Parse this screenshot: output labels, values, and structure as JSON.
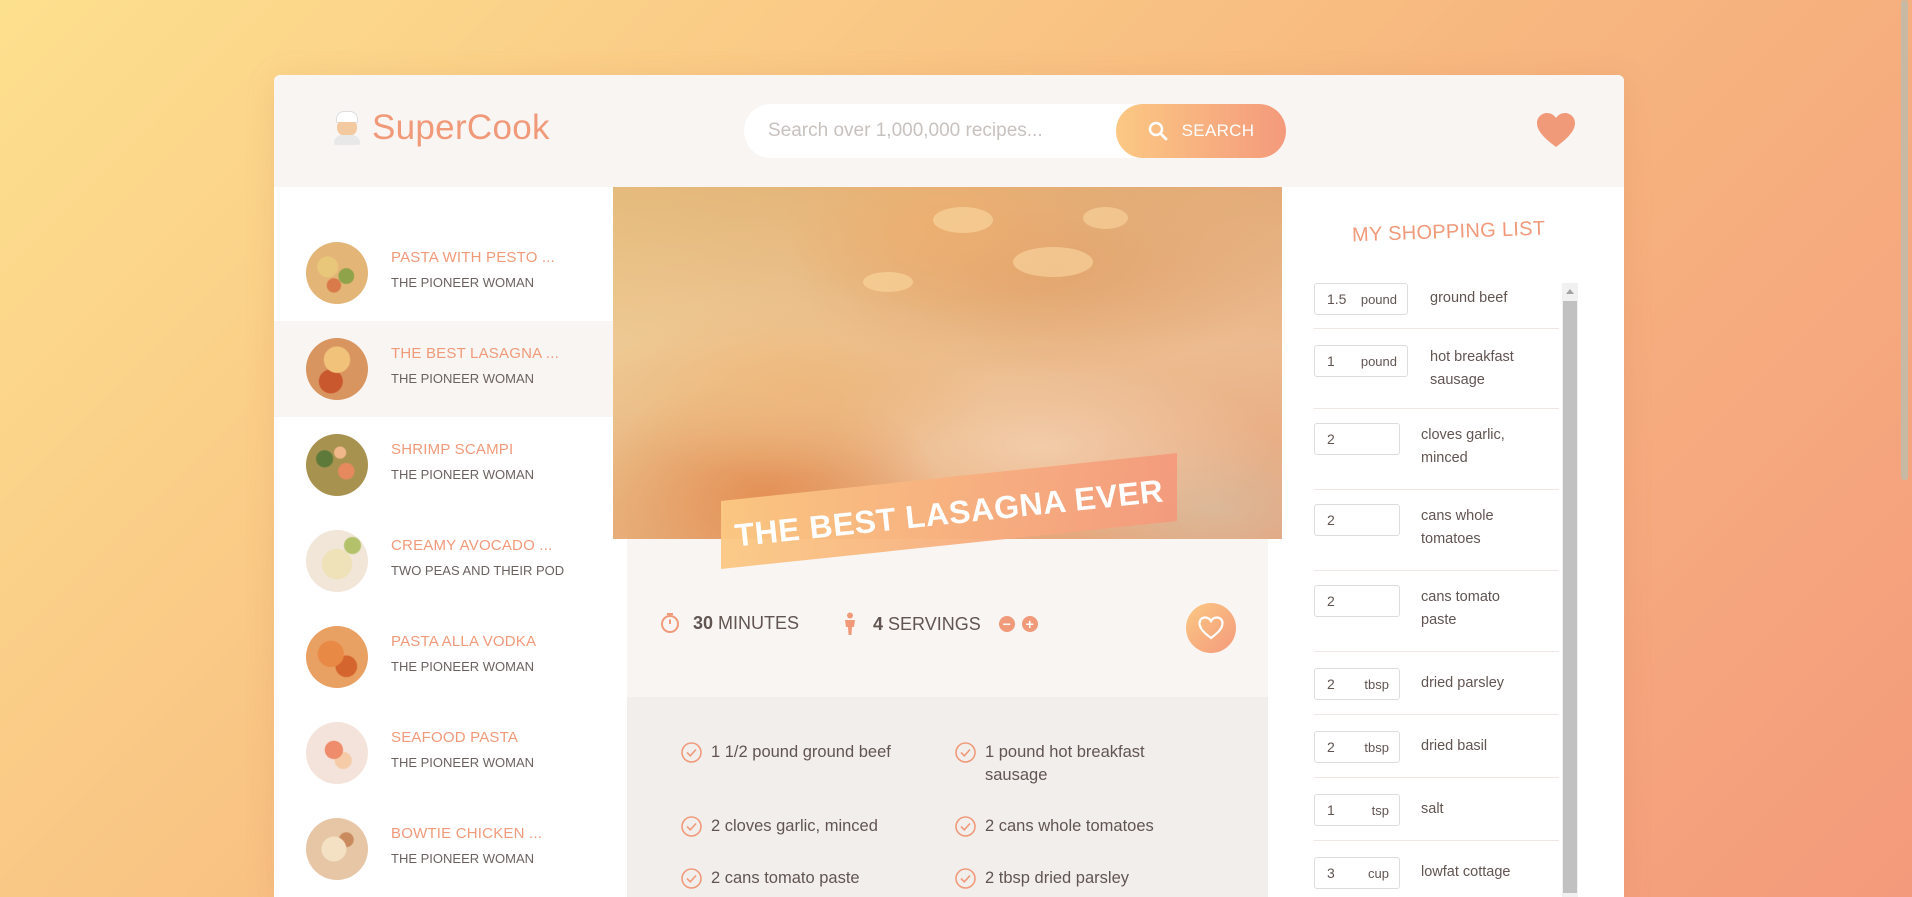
{
  "brand": {
    "name": "SuperCook",
    "logo_icon": "chef-icon"
  },
  "search": {
    "placeholder": "Search over 1,000,000 recipes...",
    "button_label": "SEARCH"
  },
  "results": [
    {
      "title": "PASTA WITH PESTO ...",
      "author": "THE PIONEER WOMAN",
      "active": false
    },
    {
      "title": "THE BEST LASAGNA ...",
      "author": "THE PIONEER WOMAN",
      "active": true
    },
    {
      "title": "SHRIMP SCAMPI",
      "author": "THE PIONEER WOMAN",
      "active": false
    },
    {
      "title": "CREAMY AVOCADO ...",
      "author": "TWO PEAS AND THEIR POD",
      "active": false
    },
    {
      "title": "PASTA ALLA VODKA",
      "author": "THE PIONEER WOMAN",
      "active": false
    },
    {
      "title": "SEAFOOD PASTA",
      "author": "THE PIONEER WOMAN",
      "active": false
    },
    {
      "title": "BOWTIE CHICKEN ...",
      "author": "THE PIONEER WOMAN",
      "active": false
    }
  ],
  "recipe": {
    "title": "THE BEST LASAGNA EVER",
    "time_value": "30",
    "time_unit": "MINUTES",
    "servings_value": "4",
    "servings_unit": "SERVINGS",
    "ingredients": [
      "1 1/2 pound ground beef",
      "1 pound hot breakfast sausage",
      "2 cloves garlic, minced",
      "2 cans whole tomatoes",
      "2 cans tomato paste",
      "2 tbsp dried parsley"
    ]
  },
  "shopping": {
    "title": "MY SHOPPING LIST",
    "items": [
      {
        "qty": "1.5",
        "unit": "pound",
        "name": "ground beef"
      },
      {
        "qty": "1",
        "unit": "pound",
        "name": "hot breakfast sausage"
      },
      {
        "qty": "2",
        "unit": "",
        "name": "cloves garlic, minced"
      },
      {
        "qty": "2",
        "unit": "",
        "name": "cans whole tomatoes"
      },
      {
        "qty": "2",
        "unit": "",
        "name": "cans tomato paste"
      },
      {
        "qty": "2",
        "unit": "tbsp",
        "name": "dried parsley"
      },
      {
        "qty": "2",
        "unit": "tbsp",
        "name": "dried basil"
      },
      {
        "qty": "1",
        "unit": "tsp",
        "name": "salt"
      },
      {
        "qty": "3",
        "unit": "cup",
        "name": "lowfat cottage"
      }
    ]
  },
  "colors": {
    "accent": "#f09a7a",
    "gradient_start": "#fbc883",
    "gradient_end": "#f49a7c",
    "text": "#615551"
  }
}
